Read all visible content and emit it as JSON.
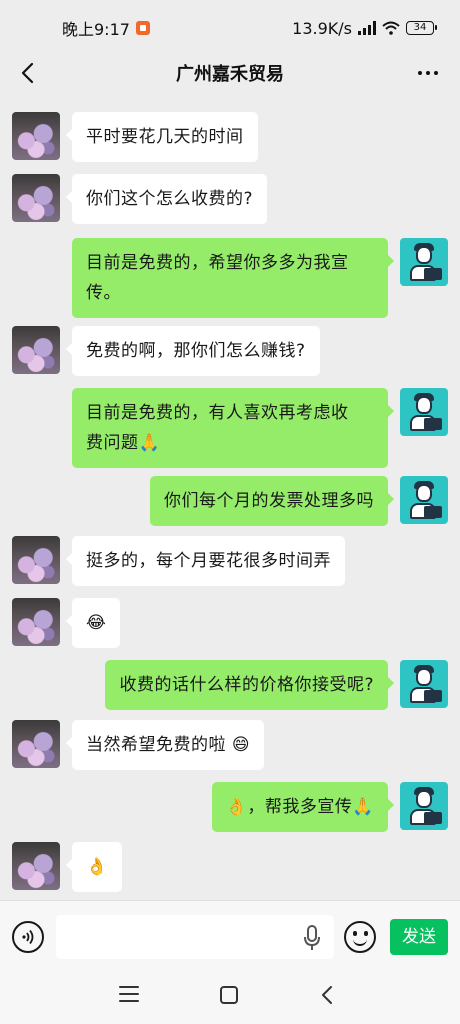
{
  "status_bar": {
    "time": "晚上9:17",
    "network_speed": "13.9K/s",
    "battery": "34"
  },
  "header": {
    "title": "广州嘉禾贸易"
  },
  "messages": [
    {
      "side": "other",
      "text": "平时要花几天的时间"
    },
    {
      "side": "other",
      "text": "你们这个怎么收费的?"
    },
    {
      "side": "self",
      "text": "目前是免费的，希望你多多为我宣\n传。"
    },
    {
      "side": "other",
      "text": "免费的啊，那你们怎么赚钱?"
    },
    {
      "side": "self",
      "text": "目前是免费的，有人喜欢再考虑收\n费问题🙏"
    },
    {
      "side": "self",
      "text": "你们每个月的发票处理多吗"
    },
    {
      "side": "other",
      "text": "挺多的，每个月要花很多时间弄"
    },
    {
      "side": "other",
      "text": "😂"
    },
    {
      "side": "self",
      "text": "收费的话什么样的价格你接受呢?"
    },
    {
      "side": "other",
      "text": "当然希望免费的啦 😄"
    },
    {
      "side": "self",
      "text": "👌，帮我多宣传🙏"
    },
    {
      "side": "other",
      "text": "👌"
    }
  ],
  "input_bar": {
    "placeholder": "",
    "send_label": "发送"
  },
  "icons": {
    "back": "chevron-left-icon",
    "more": "more-dots-icon",
    "voice": "voice-icon",
    "mic": "mic-icon",
    "emoji": "emoji-icon",
    "nav_menu": "menu-icon",
    "nav_home": "home-icon",
    "nav_back": "back-icon"
  },
  "colors": {
    "self_bubble": "#95ec69",
    "other_bubble": "#ffffff",
    "send_button": "#07c160",
    "background": "#ededed"
  }
}
